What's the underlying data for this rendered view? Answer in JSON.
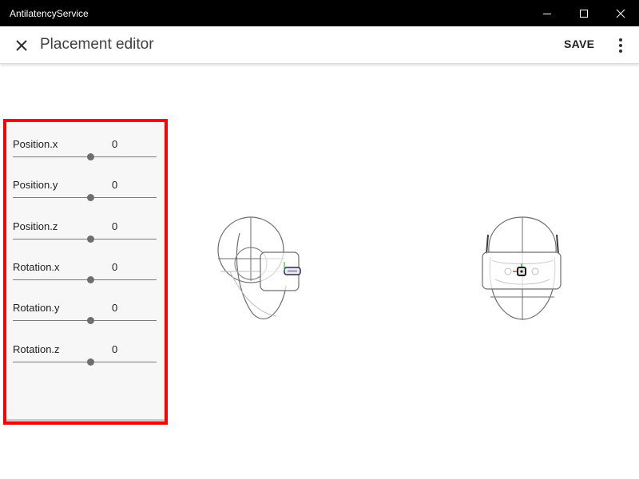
{
  "window": {
    "title": "AntilatencyService",
    "controls": {
      "minimize_icon": "minimize-icon",
      "maximize_icon": "maximize-icon",
      "close_icon": "close-icon"
    }
  },
  "header": {
    "close_icon": "close-icon",
    "title": "Placement editor",
    "save_label": "SAVE",
    "more_icon": "more-vertical-icon"
  },
  "panel": {
    "highlight_color": "#ff0000",
    "sliders": [
      {
        "label": "Position.x",
        "value": "0"
      },
      {
        "label": "Position.y",
        "value": "0"
      },
      {
        "label": "Position.z",
        "value": "0"
      },
      {
        "label": "Rotation.x",
        "value": "0"
      },
      {
        "label": "Rotation.y",
        "value": "0"
      },
      {
        "label": "Rotation.z",
        "value": "0"
      }
    ]
  },
  "preview": {
    "side_view_icon": "head-side-view-icon",
    "front_view_icon": "head-front-view-icon",
    "axis_colors": {
      "x": "#e03030",
      "y": "#30a030"
    }
  }
}
